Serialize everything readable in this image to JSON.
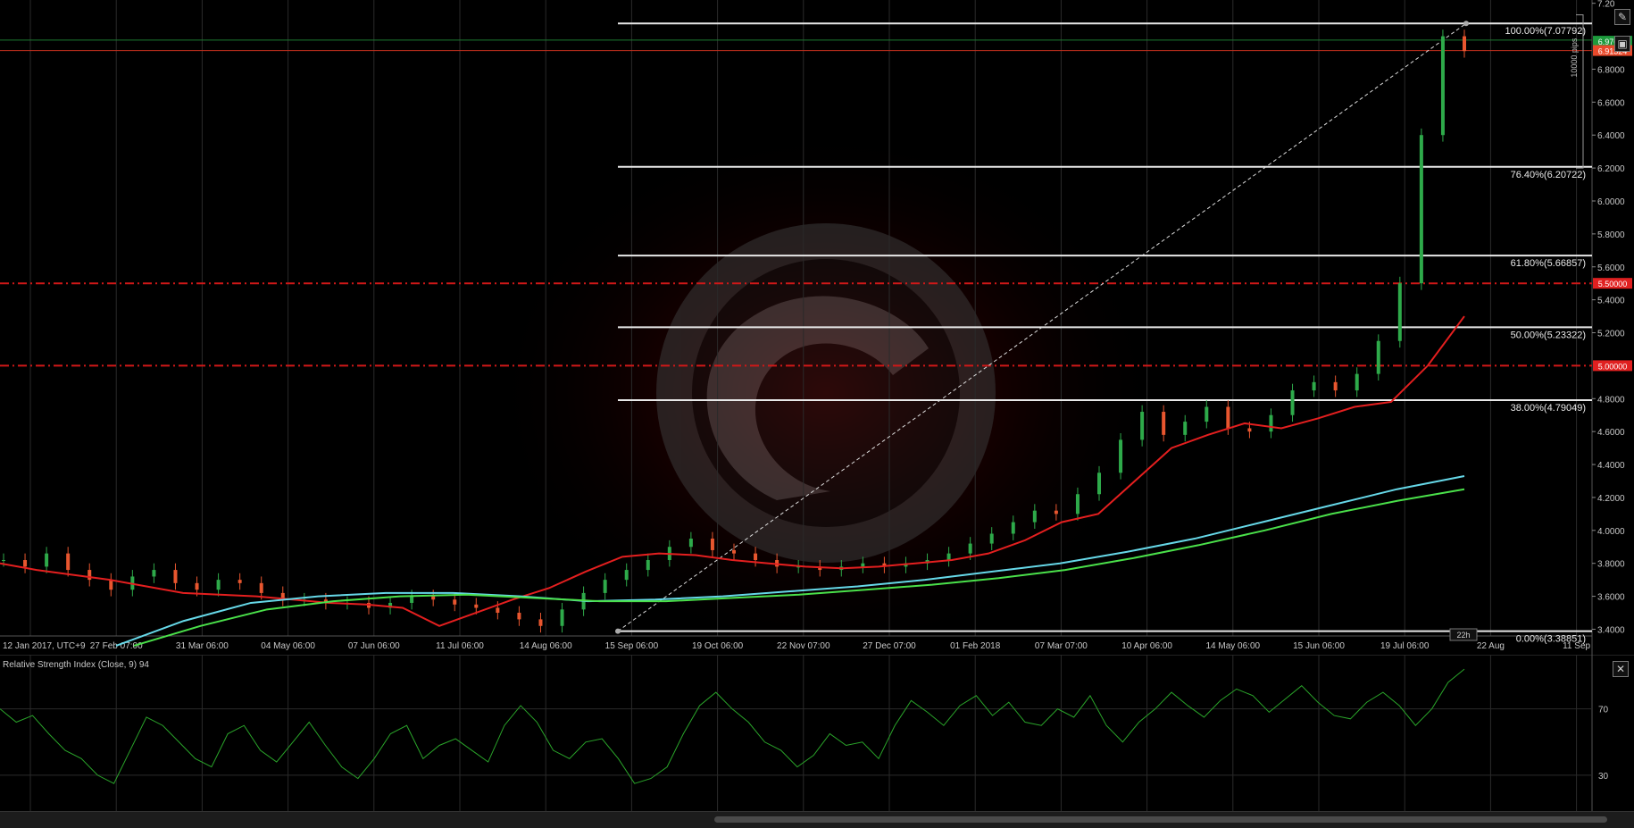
{
  "chart_data": [
    {
      "type": "candlestick",
      "x_tick_labels": [
        "12 Jan 2017, UTC+9",
        "27 Feb 07:00",
        "31 Mar 06:00",
        "04 May 06:00",
        "07 Jun 06:00",
        "11 Jul 06:00",
        "14 Aug 06:00",
        "15 Sep 06:00",
        "19 Oct 06:00",
        "22 Nov 07:00",
        "27 Dec 07:00",
        "01 Feb 2018",
        "07 Mar 07:00",
        "10 Apr 06:00",
        "14 May 06:00",
        "15 Jun 06:00",
        "19 Jul 06:00",
        "22 Aug",
        "11 Sep"
      ],
      "y_tick_labels": [
        "7.20",
        "6.8000",
        "6.6000",
        "6.4000",
        "6.2000",
        "6.0000",
        "5.8000",
        "5.6000",
        "5.4000",
        "5.2000",
        "4.8000",
        "4.6000",
        "4.4000",
        "4.2000",
        "4.0000",
        "3.8000",
        "3.6000",
        "3.4000"
      ],
      "ylim": [
        3.37,
        7.22
      ],
      "price_labels": [
        {
          "value": 6.97,
          "text": "6.97656",
          "color": "#1d9a3c"
        },
        {
          "value": 6.91324,
          "text": "6.91324",
          "color": "#e8492b"
        },
        {
          "value": 5.5,
          "text": "5.50000",
          "color": "#e02020"
        },
        {
          "value": 5.0,
          "text": "5.00000",
          "color": "#e02020"
        }
      ],
      "horizontal_levels": [
        {
          "value": 5.5,
          "style": "dash-dot",
          "color": "#d01818"
        },
        {
          "value": 5.0,
          "style": "dash-dot",
          "color": "#d01818"
        },
        {
          "value": 6.97656,
          "style": "solid",
          "color": "#1d7a32"
        },
        {
          "value": 6.91324,
          "style": "solid",
          "color": "#c8301e"
        }
      ],
      "fibonacci_levels": [
        {
          "value": 7.07792,
          "label": "100.00%(7.07792)"
        },
        {
          "value": 6.20722,
          "label": "76.40%(6.20722)"
        },
        {
          "value": 5.66857,
          "label": "61.80%(5.66857)"
        },
        {
          "value": 5.23322,
          "label": "50.00%(5.23322)"
        },
        {
          "value": 4.79049,
          "label": "38.00%(4.79049)"
        },
        {
          "value": 3.38851,
          "label": "0.00%(3.38851)"
        }
      ],
      "measure_label": "10000 pips",
      "time_badge": "22h",
      "close_series": [
        3.82,
        3.78,
        3.86,
        3.76,
        3.7,
        3.64,
        3.72,
        3.76,
        3.68,
        3.64,
        3.7,
        3.68,
        3.62,
        3.58,
        3.58,
        3.56,
        3.56,
        3.53,
        3.56,
        3.6,
        3.58,
        3.55,
        3.53,
        3.5,
        3.46,
        3.42,
        3.52,
        3.62,
        3.7,
        3.76,
        3.82,
        3.9,
        3.95,
        3.88,
        3.86,
        3.82,
        3.78,
        3.78,
        3.76,
        3.78,
        3.8,
        3.78,
        3.8,
        3.82,
        3.86,
        3.92,
        3.98,
        4.05,
        4.12,
        4.1,
        4.22,
        4.35,
        4.55,
        4.72,
        4.58,
        4.66,
        4.75,
        4.62,
        4.6,
        4.7,
        4.85,
        4.9,
        4.85,
        4.95,
        5.15,
        5.5,
        6.4,
        7.0,
        6.91
      ],
      "ema_red": [
        3.8,
        3.76,
        3.73,
        3.7,
        3.66,
        3.62,
        3.61,
        3.6,
        3.58,
        3.56,
        3.55,
        3.53,
        3.42,
        3.5,
        3.58,
        3.65,
        3.75,
        3.84,
        3.86,
        3.85,
        3.82,
        3.8,
        3.78,
        3.77,
        3.78,
        3.8,
        3.82,
        3.86,
        3.94,
        4.05,
        4.1,
        4.3,
        4.5,
        4.58,
        4.65,
        4.62,
        4.68,
        4.75,
        4.78,
        5.0,
        5.3
      ],
      "ma_cyan": [
        3.3,
        3.45,
        3.56,
        3.6,
        3.62,
        3.62,
        3.6,
        3.57,
        3.58,
        3.6,
        3.63,
        3.66,
        3.7,
        3.75,
        3.8,
        3.87,
        3.95,
        4.05,
        4.15,
        4.25,
        4.33
      ],
      "ma_green": [
        3.3,
        3.42,
        3.52,
        3.57,
        3.6,
        3.61,
        3.59,
        3.57,
        3.57,
        3.59,
        3.61,
        3.64,
        3.67,
        3.71,
        3.76,
        3.83,
        3.91,
        4.0,
        4.1,
        4.18,
        4.25
      ]
    },
    {
      "type": "line",
      "title": "Relative Strength Index (Close, 9) 94",
      "y_tick_labels": [
        "70",
        "30"
      ],
      "ylim": [
        10,
        100
      ],
      "values": [
        70,
        62,
        66,
        55,
        45,
        40,
        30,
        25,
        45,
        65,
        60,
        50,
        40,
        35,
        55,
        60,
        45,
        38,
        50,
        62,
        48,
        35,
        28,
        40,
        55,
        60,
        40,
        48,
        52,
        45,
        38,
        60,
        72,
        62,
        45,
        40,
        50,
        52,
        40,
        25,
        28,
        35,
        55,
        72,
        80,
        70,
        62,
        50,
        45,
        35,
        42,
        55,
        48,
        50,
        40,
        60,
        75,
        68,
        60,
        72,
        78,
        66,
        74,
        62,
        60,
        70,
        65,
        78,
        60,
        50,
        62,
        70,
        80,
        72,
        65,
        75,
        82,
        78,
        68,
        76,
        84,
        74,
        66,
        64,
        74,
        80,
        72,
        60,
        70,
        86,
        94
      ]
    }
  ]
}
